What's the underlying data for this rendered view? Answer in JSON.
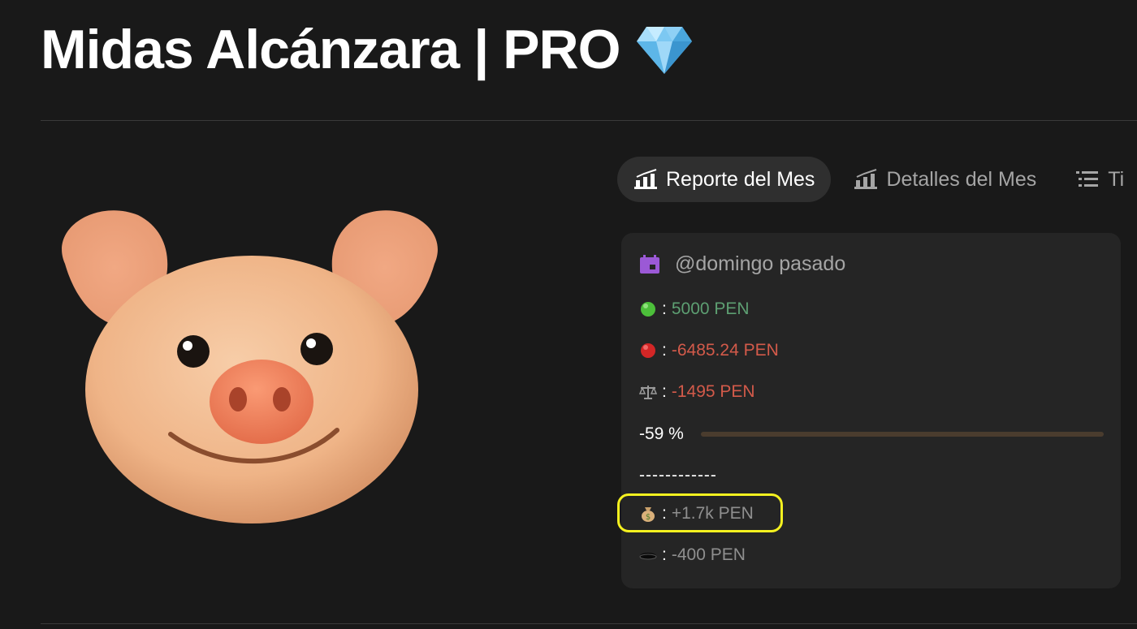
{
  "page": {
    "title": "Midas Alcánzara |  PRO",
    "title_icon": "gem-icon"
  },
  "tabs": [
    {
      "label": "Reporte del Mes",
      "icon": "chart-icon",
      "active": true
    },
    {
      "label": "Detalles del Mes",
      "icon": "chart-icon",
      "active": false
    },
    {
      "label": "Ti",
      "icon": "list-icon",
      "active": false
    }
  ],
  "card": {
    "header": "@domingo pasado",
    "header_icon": "calendar-icon",
    "income": {
      "icon": "green-circle-icon",
      "colon": ":",
      "value": "5000 PEN",
      "color": "#5d9f72"
    },
    "expense": {
      "icon": "red-circle-icon",
      "colon": ":",
      "value": "-6485.24 PEN",
      "color": "#d35a4a"
    },
    "balance": {
      "icon": "scale-icon",
      "colon": ":",
      "value": "-1495 PEN",
      "color": "#d35a4a"
    },
    "progress": {
      "label": "-59 %",
      "fraction": 0.0
    },
    "separator": "------------",
    "savings": {
      "icon": "money-bag-icon",
      "colon": ":",
      "value": "+1.7k PEN"
    },
    "hole": {
      "icon": "hole-icon",
      "colon": ":",
      "value": "-400 PEN"
    }
  },
  "colors": {
    "background": "#191919",
    "card": "#252525",
    "highlight": "#f5f11f"
  }
}
